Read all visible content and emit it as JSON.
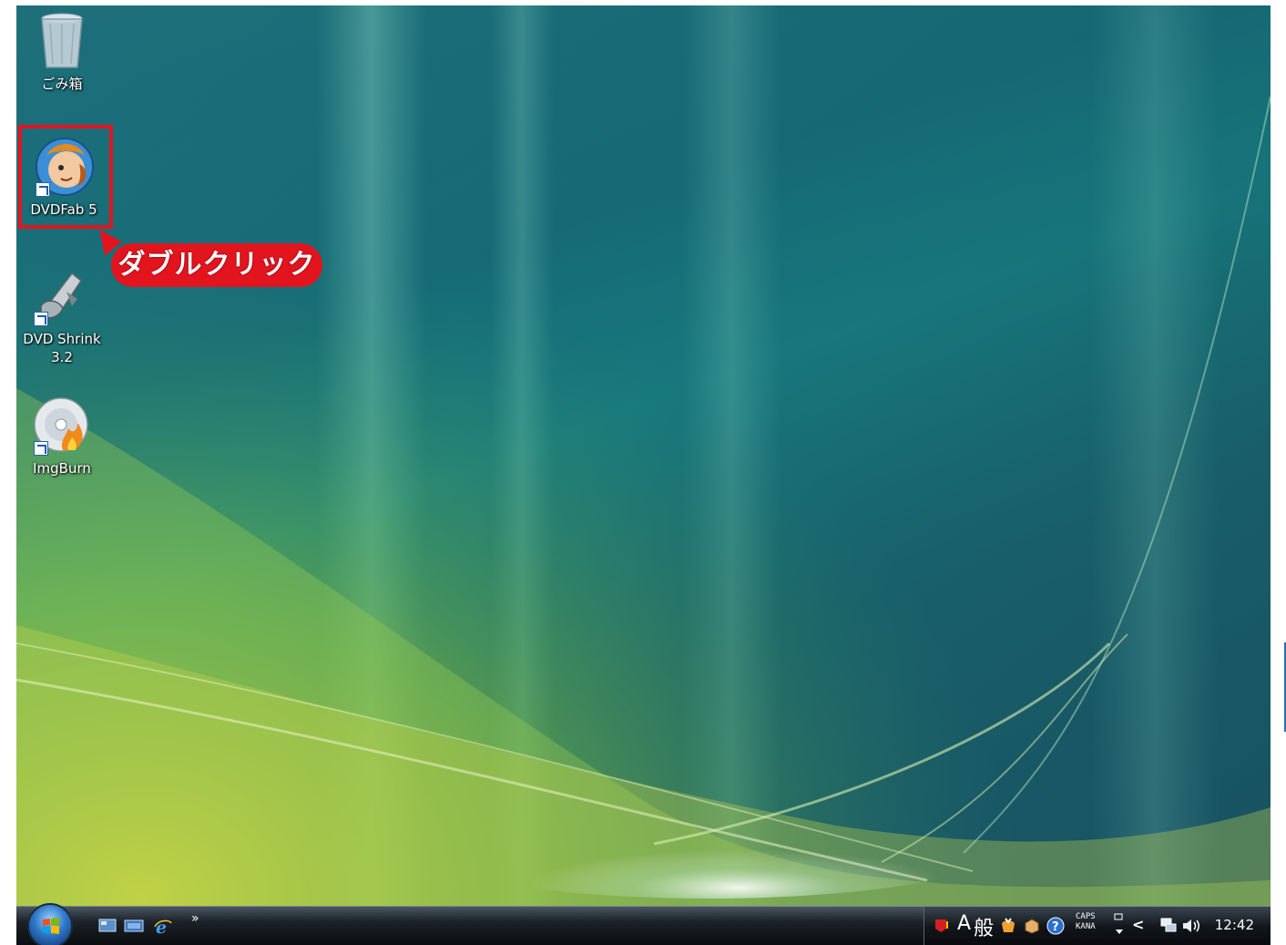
{
  "desktop": {
    "icons": [
      {
        "label": "ごみ箱",
        "icon": "recycle-bin-icon"
      },
      {
        "label": "DVDFab 5",
        "icon": "dvdfab-icon"
      },
      {
        "label_line1": "DVD Shrink",
        "label_line2": "3.2",
        "icon": "dvd-shrink-icon"
      },
      {
        "label": "ImgBurn",
        "icon": "imgburn-icon"
      }
    ],
    "callout": "ダブルクリック"
  },
  "taskbar": {
    "quick_launch_more": "»",
    "ime_mode": "A",
    "ime_kanji": "般",
    "caps": "CAPS",
    "kana": "KANA",
    "tray_expand": "<",
    "clock": "12:42"
  },
  "colors": {
    "annotation_red": "#e2151f",
    "taskbar": "#0b0e11"
  }
}
